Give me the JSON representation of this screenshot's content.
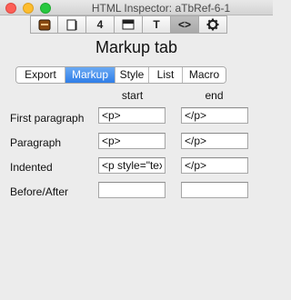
{
  "window": {
    "title": "HTML Inspector: aTbRef-6-1"
  },
  "toolbar": {
    "buttons": [
      {
        "icon": "stack-icon",
        "glyph": "▮"
      },
      {
        "icon": "page-icon",
        "glyph": "❐"
      },
      {
        "icon": "badge-icon",
        "glyph": "4"
      },
      {
        "icon": "window-icon",
        "glyph": "▭"
      },
      {
        "icon": "text-icon",
        "glyph": "T"
      },
      {
        "icon": "code-icon",
        "glyph": "<>"
      },
      {
        "icon": "gear-icon",
        "glyph": "⚙"
      }
    ],
    "active_index": 5
  },
  "panel": {
    "title": "Markup tab"
  },
  "tabs": [
    {
      "label": "Export"
    },
    {
      "label": "Markup",
      "selected": true
    },
    {
      "label": "Style"
    },
    {
      "label": "List"
    },
    {
      "label": "Macro"
    }
  ],
  "columns": {
    "start": "start",
    "end": "end"
  },
  "rows": [
    {
      "label": "First paragraph",
      "start": "<p>",
      "end": "</p>"
    },
    {
      "label": "Paragraph",
      "start": "<p>",
      "end": "</p>"
    },
    {
      "label": "Indented",
      "start": "<p style=\"tex",
      "end": "</p>"
    },
    {
      "label": "Before/After",
      "start": "",
      "end": ""
    }
  ]
}
